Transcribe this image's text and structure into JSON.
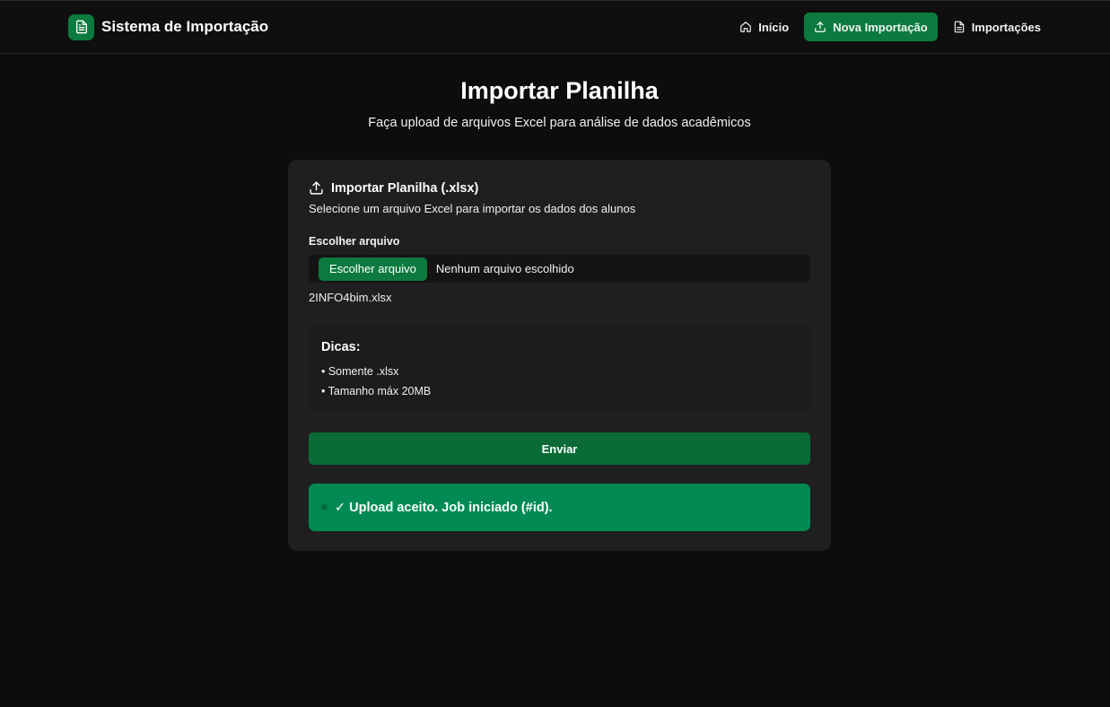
{
  "brand": {
    "title": "Sistema de Importação",
    "icon": "file-text-icon"
  },
  "nav": {
    "items": [
      {
        "label": "Início",
        "icon": "home-icon",
        "active": false
      },
      {
        "label": "Nova Importação",
        "icon": "upload-icon",
        "active": true
      },
      {
        "label": "Importações",
        "icon": "file-text-icon",
        "active": false
      }
    ]
  },
  "hero": {
    "title": "Importar Planilha",
    "subtitle": "Faça upload de arquivos Excel para análise de dados acadêmicos"
  },
  "card": {
    "title": "Importar Planilha (.xlsx)",
    "description": "Selecione um arquivo Excel para importar os dados dos alunos",
    "file_label": "Escolher arquivo",
    "file_button": "Escolher arquivo",
    "file_status": "Nenhum arquivo escolhido",
    "selected_file": "2INFO4bim.xlsx",
    "tips": {
      "title": "Dicas:",
      "items": [
        "• Somente .xlsx",
        "• Tamanho máx 20MB"
      ]
    },
    "submit_label": "Enviar",
    "alert": "✓ Upload aceito. Job iniciado (#id)."
  },
  "colors": {
    "accent": "#0c7a3e",
    "background": "#0d0d0d",
    "card": "#1f1f1f",
    "success": "#028a55"
  }
}
